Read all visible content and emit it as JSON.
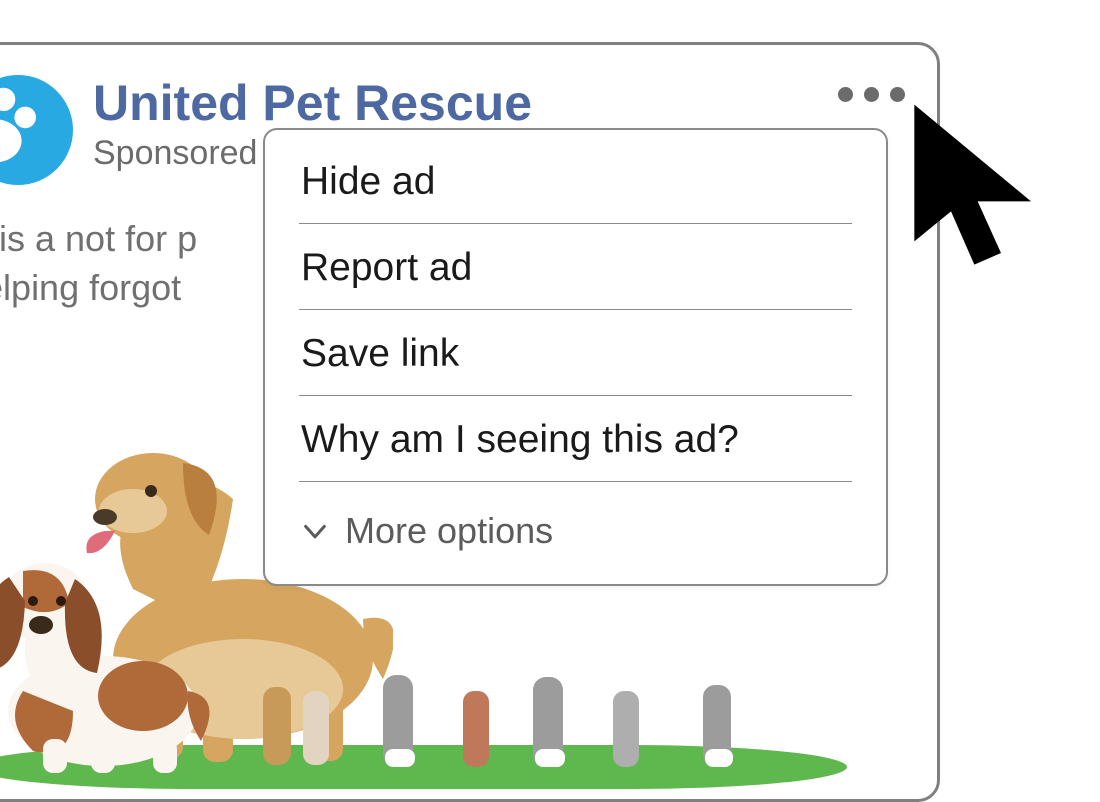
{
  "post": {
    "page_name": "United Pet Rescue",
    "sponsored_label": "Sponsored",
    "body_line1": "R is a not for p",
    "body_line2": "helping forgot"
  },
  "menu": {
    "items": [
      {
        "label": "Hide ad"
      },
      {
        "label": "Report ad"
      },
      {
        "label": "Save link"
      },
      {
        "label": "Why am I seeing this ad?"
      }
    ],
    "more_label": "More options"
  },
  "icons": {
    "avatar": "paw-icon",
    "overflow": "more-dots-icon",
    "chevron": "chevron-down-icon",
    "cursor": "mouse-cursor-icon"
  },
  "colors": {
    "brand_blue": "#29a9e1",
    "link_blue": "#4e69a2",
    "grass": "#5fb84d"
  }
}
